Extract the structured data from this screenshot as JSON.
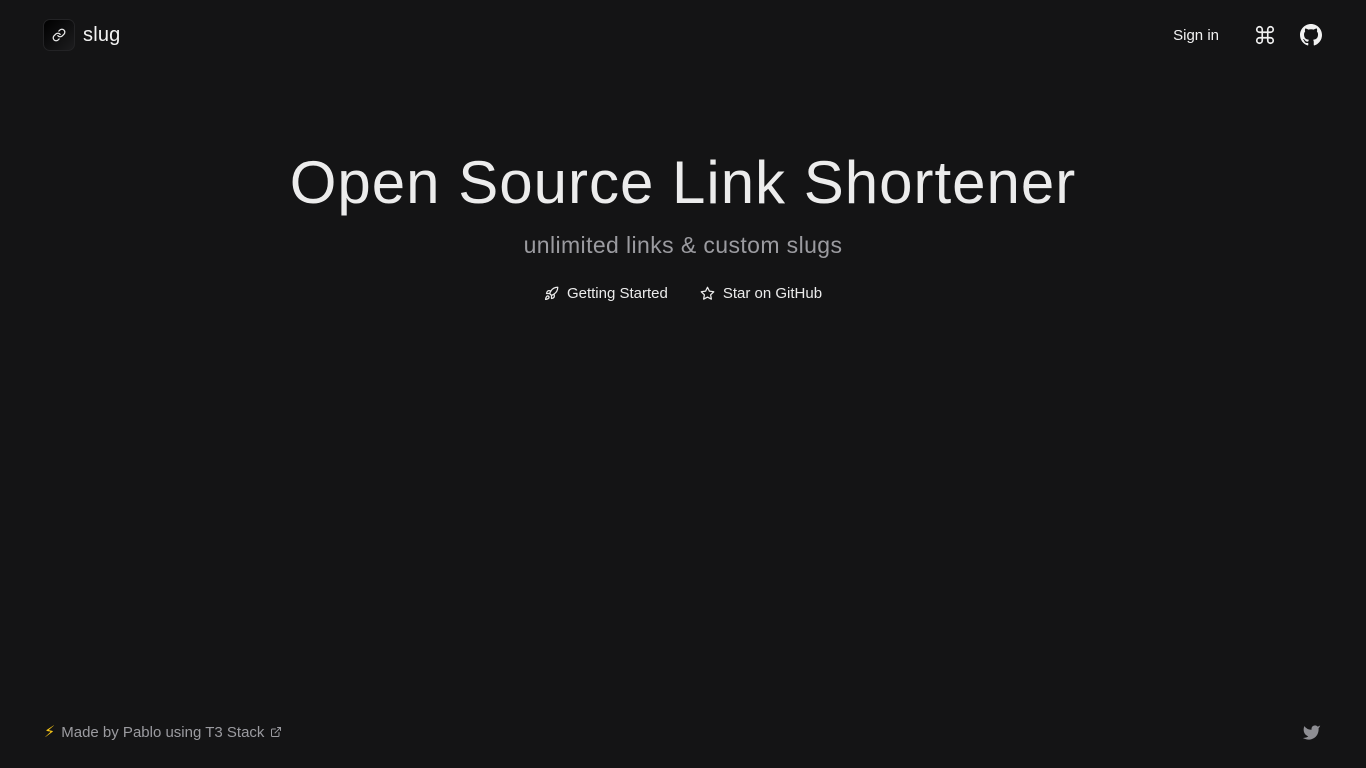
{
  "header": {
    "brand_name": "slug",
    "signin_label": "Sign in",
    "icons": [
      "link-icon",
      "command-icon",
      "github-icon"
    ]
  },
  "hero": {
    "title": "Open Source Link Shortener",
    "subtitle": "unlimited links & custom slugs",
    "cta_getting_started": "Getting Started",
    "cta_star": "Star on GitHub",
    "icons": [
      "rocket-icon",
      "star-icon"
    ]
  },
  "footer": {
    "bolt": "⚡",
    "madeby_text": "Made by Pablo using T3 Stack",
    "icons": [
      "external-link-icon",
      "twitter-icon"
    ]
  },
  "colors": {
    "background": "#141415",
    "text": "#ececec",
    "muted": "#9b9ba0",
    "accent_bolt": "#f5c518"
  }
}
